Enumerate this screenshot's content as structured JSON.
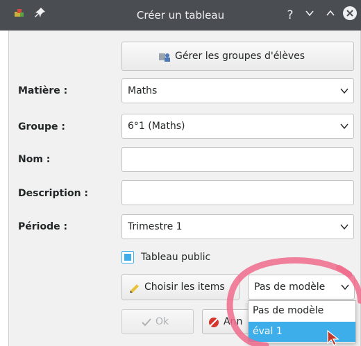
{
  "window": {
    "title": "Créer un tableau",
    "help_glyph": "?",
    "minimize_glyph": "⌄",
    "maximize_glyph": "^",
    "close_glyph": "✕"
  },
  "manage_groups_button": {
    "label": "Gérer les groupes d'élèves"
  },
  "form": {
    "subject": {
      "label": "Matière :",
      "value": "Maths"
    },
    "group": {
      "label": "Groupe :",
      "value": "6°1 (Maths)"
    },
    "name": {
      "label": "Nom :",
      "value": ""
    },
    "description": {
      "label": "Description :",
      "value": ""
    },
    "period": {
      "label": "Période :",
      "value": "Trimestre 1"
    },
    "public_checkbox": {
      "label": "Tableau public",
      "checked": true
    }
  },
  "choose_items_button": {
    "label": "Choisir les items"
  },
  "template_select": {
    "value": "Pas de modèle",
    "options": [
      "Pas de modèle",
      "éval 1"
    ],
    "highlighted": "éval 1"
  },
  "footer": {
    "ok_label": "Ok",
    "cancel_label_partial": "Ann"
  },
  "colors": {
    "titlebar": "#4a4d52",
    "accent": "#3daee9",
    "annotation": "#f06b8c"
  }
}
